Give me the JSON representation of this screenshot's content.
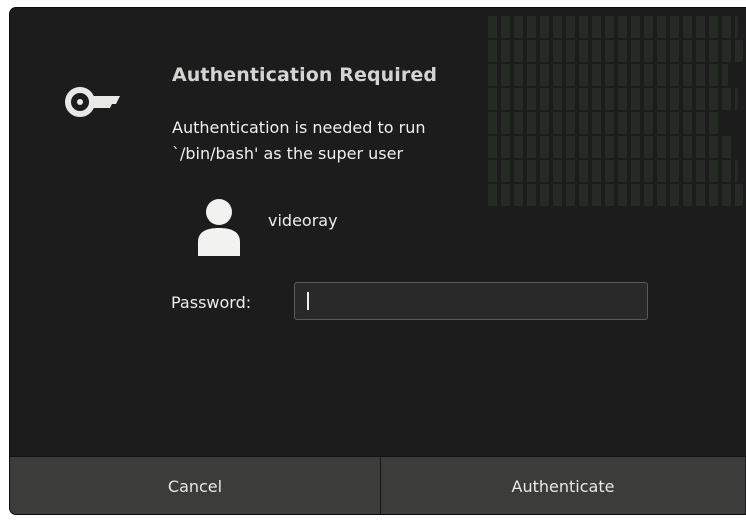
{
  "dialog": {
    "title": "Authentication Required",
    "message": "Authentication is needed to run `/bin/bash' as the super user",
    "icons": {
      "main": "key-icon",
      "user": "avatar-icon"
    },
    "user": {
      "name": "videoray"
    },
    "password": {
      "label": "Password:",
      "value": ""
    },
    "buttons": {
      "cancel": "Cancel",
      "authenticate": "Authenticate"
    }
  },
  "colors": {
    "background": "#1b1c1b",
    "footer": "#3c3d3b",
    "text": "#eeeeec",
    "input_border": "#5a5b59"
  }
}
